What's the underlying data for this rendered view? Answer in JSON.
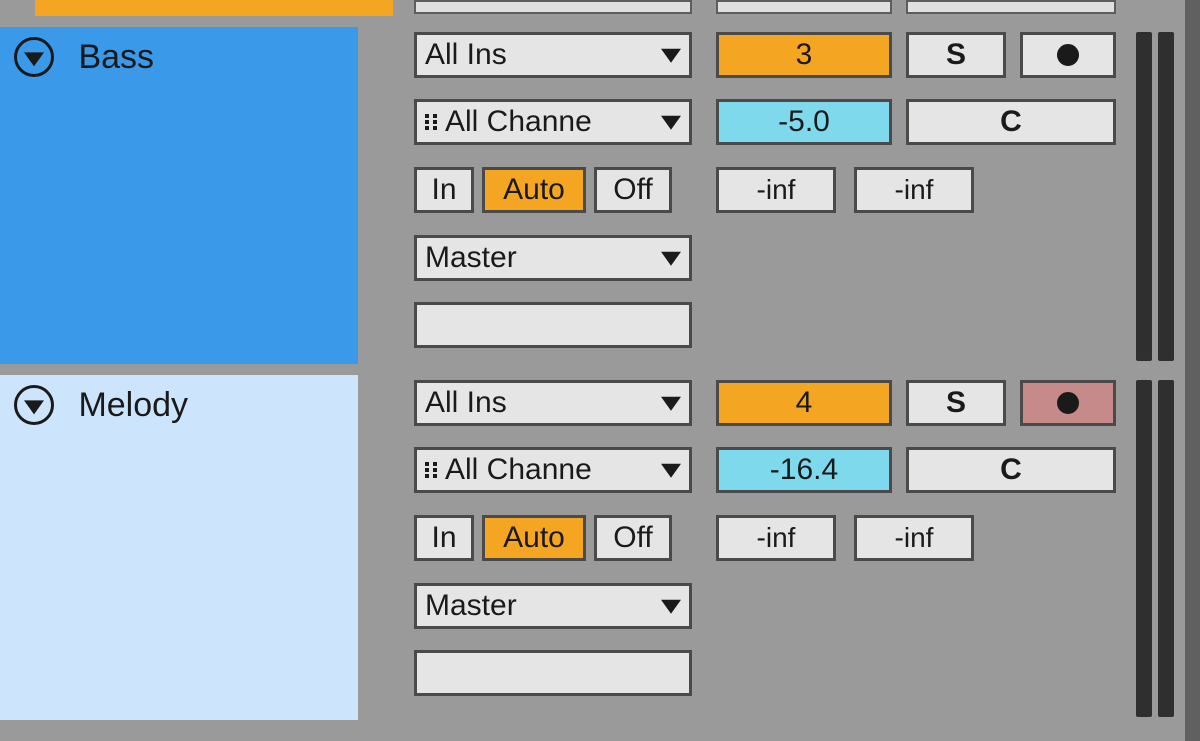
{
  "tracks": [
    {
      "name": "Bass",
      "color": "bass",
      "io": {
        "input_type": "All Ins",
        "input_channel": "All Channe",
        "monitor_in": "In",
        "monitor_auto": "Auto",
        "monitor_off": "Off",
        "monitor_state": "Auto",
        "output": "Master",
        "output_channel": ""
      },
      "mix": {
        "track_number": "3",
        "solo": "S",
        "record_armed": false,
        "volume_db": "-5.0",
        "cue": "C",
        "send_a": "-inf",
        "send_b": "-inf"
      }
    },
    {
      "name": "Melody",
      "color": "melody",
      "io": {
        "input_type": "All Ins",
        "input_channel": "All Channe",
        "monitor_in": "In",
        "monitor_auto": "Auto",
        "monitor_off": "Off",
        "monitor_state": "Auto",
        "output": "Master",
        "output_channel": ""
      },
      "mix": {
        "track_number": "4",
        "solo": "S",
        "record_armed": true,
        "volume_db": "-16.4",
        "cue": "C",
        "send_a": "-inf",
        "send_b": "-inf"
      }
    }
  ]
}
